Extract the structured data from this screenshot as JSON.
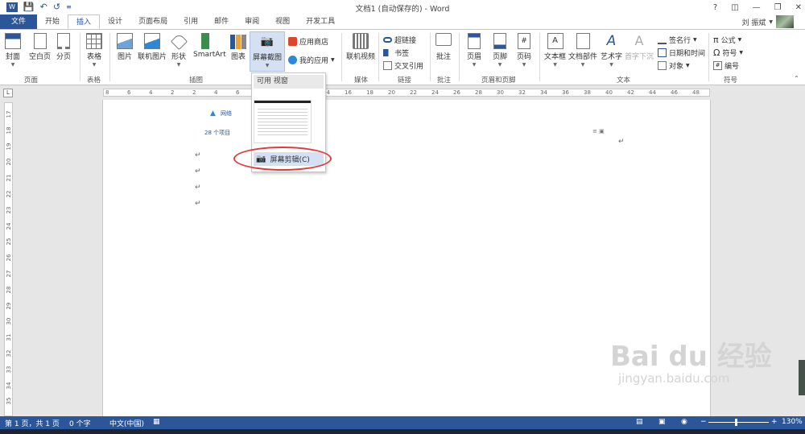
{
  "app": {
    "title": "文档1 (自动保存的) - Word",
    "user": "刘 振斌",
    "qat": [
      "save-icon",
      "undo-icon",
      "redo-icon",
      "customize-icon"
    ]
  },
  "tabs": [
    "文件",
    "开始",
    "插入",
    "设计",
    "页面布局",
    "引用",
    "邮件",
    "审阅",
    "视图",
    "开发工具"
  ],
  "ribbon": {
    "pages": {
      "cover": "封面",
      "blank": "空白页",
      "break": "分页",
      "group": "页面"
    },
    "tables": {
      "table": "表格",
      "group": "表格"
    },
    "illustrations": {
      "pictures": "图片",
      "online": "联机图片",
      "shapes": "形状",
      "smartart": "SmartArt",
      "chart": "图表",
      "screenshot": "屏幕截图",
      "group": "插图"
    },
    "apps": {
      "store": "应用商店",
      "myapps": "我的应用"
    },
    "media": {
      "video": "联机视频",
      "group": "媒体"
    },
    "links": {
      "hyperlink": "超链接",
      "bookmark": "书签",
      "crossref": "交叉引用",
      "group": "链接"
    },
    "comments": {
      "comment": "批注",
      "group": "批注"
    },
    "headerfooter": {
      "header": "页眉",
      "footer": "页脚",
      "pagenum": "页码",
      "group": "页眉和页脚"
    },
    "text": {
      "textbox": "文本框",
      "parts": "文档部件",
      "wordart": "艺术字",
      "dropcap": "首字下沉",
      "sigline": "签名行",
      "datetime": "日期和时间",
      "object": "对象",
      "group": "文本"
    },
    "symbols": {
      "equation": "公式",
      "symbol": "符号",
      "number": "编号",
      "group": "符号"
    }
  },
  "dropdown": {
    "header": "可用 视窗",
    "clipping": "屏幕剪辑(C)"
  },
  "ruler": {
    "h": [
      "8",
      "6",
      "4",
      "2",
      "2",
      "4",
      "6",
      "8",
      "10",
      "12",
      "14",
      "16",
      "18",
      "20",
      "22",
      "24",
      "26",
      "28",
      "30",
      "32",
      "34",
      "36",
      "38",
      "40",
      "42",
      "44",
      "46",
      "48"
    ],
    "v": [
      "17",
      "18",
      "19",
      "20",
      "21",
      "22",
      "23",
      "24",
      "25",
      "26",
      "27",
      "28",
      "29",
      "30",
      "31",
      "32",
      "33",
      "34",
      "35"
    ]
  },
  "doc": {
    "network": "网络",
    "items": "28 个项目",
    "para_mark": "↵"
  },
  "status": {
    "page": "第 1 页，共 1 页",
    "words": "0 个字",
    "lang": "中文(中国)",
    "zoom": "130%"
  },
  "watermark": {
    "brand": "Bai  du 经验",
    "url": "jingyan.baidu.com"
  }
}
